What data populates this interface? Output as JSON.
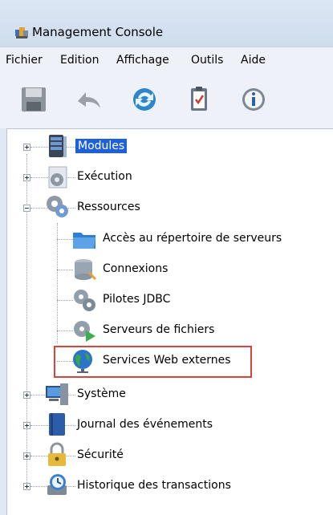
{
  "window": {
    "title": "Management Console"
  },
  "menu": {
    "items": [
      {
        "label": "Fichier"
      },
      {
        "label": "Edition"
      },
      {
        "label": "Affichage"
      },
      {
        "label": "Outils"
      },
      {
        "label": "Aide"
      }
    ]
  },
  "toolbar": {
    "buttons": [
      {
        "icon": "save-icon"
      },
      {
        "icon": "undo-icon"
      },
      {
        "icon": "refresh-icon"
      },
      {
        "icon": "clipboard-icon"
      },
      {
        "icon": "info-icon"
      }
    ]
  },
  "tree": {
    "nodes": [
      {
        "label": "Modules",
        "icon": "modules-server-icon",
        "state": "collapsed",
        "selected": true
      },
      {
        "label": "Exécution",
        "icon": "gear-icon",
        "state": "collapsed"
      },
      {
        "label": "Ressources",
        "icon": "resources-gear-icon",
        "state": "expanded",
        "children": [
          {
            "label": "Accès au répertoire de serveurs",
            "icon": "folder-icon"
          },
          {
            "label": "Connexions",
            "icon": "database-icon"
          },
          {
            "label": "Pilotes JDBC",
            "icon": "gears-icon"
          },
          {
            "label": "Serveurs de fichiers",
            "icon": "file-server-icon"
          },
          {
            "label": "Services Web externes",
            "icon": "globe-icon",
            "highlighted": true
          }
        ]
      },
      {
        "label": "Système",
        "icon": "computer-icon",
        "state": "collapsed"
      },
      {
        "label": "Journal des événements",
        "icon": "journal-book-icon",
        "state": "collapsed"
      },
      {
        "label": "Sécurité",
        "icon": "lock-icon",
        "state": "collapsed"
      },
      {
        "label": "Historique des transactions",
        "icon": "history-clock-icon",
        "state": "collapsed"
      }
    ]
  },
  "colors": {
    "selection": "#1e5fdc",
    "highlight_border": "#d9443a"
  }
}
